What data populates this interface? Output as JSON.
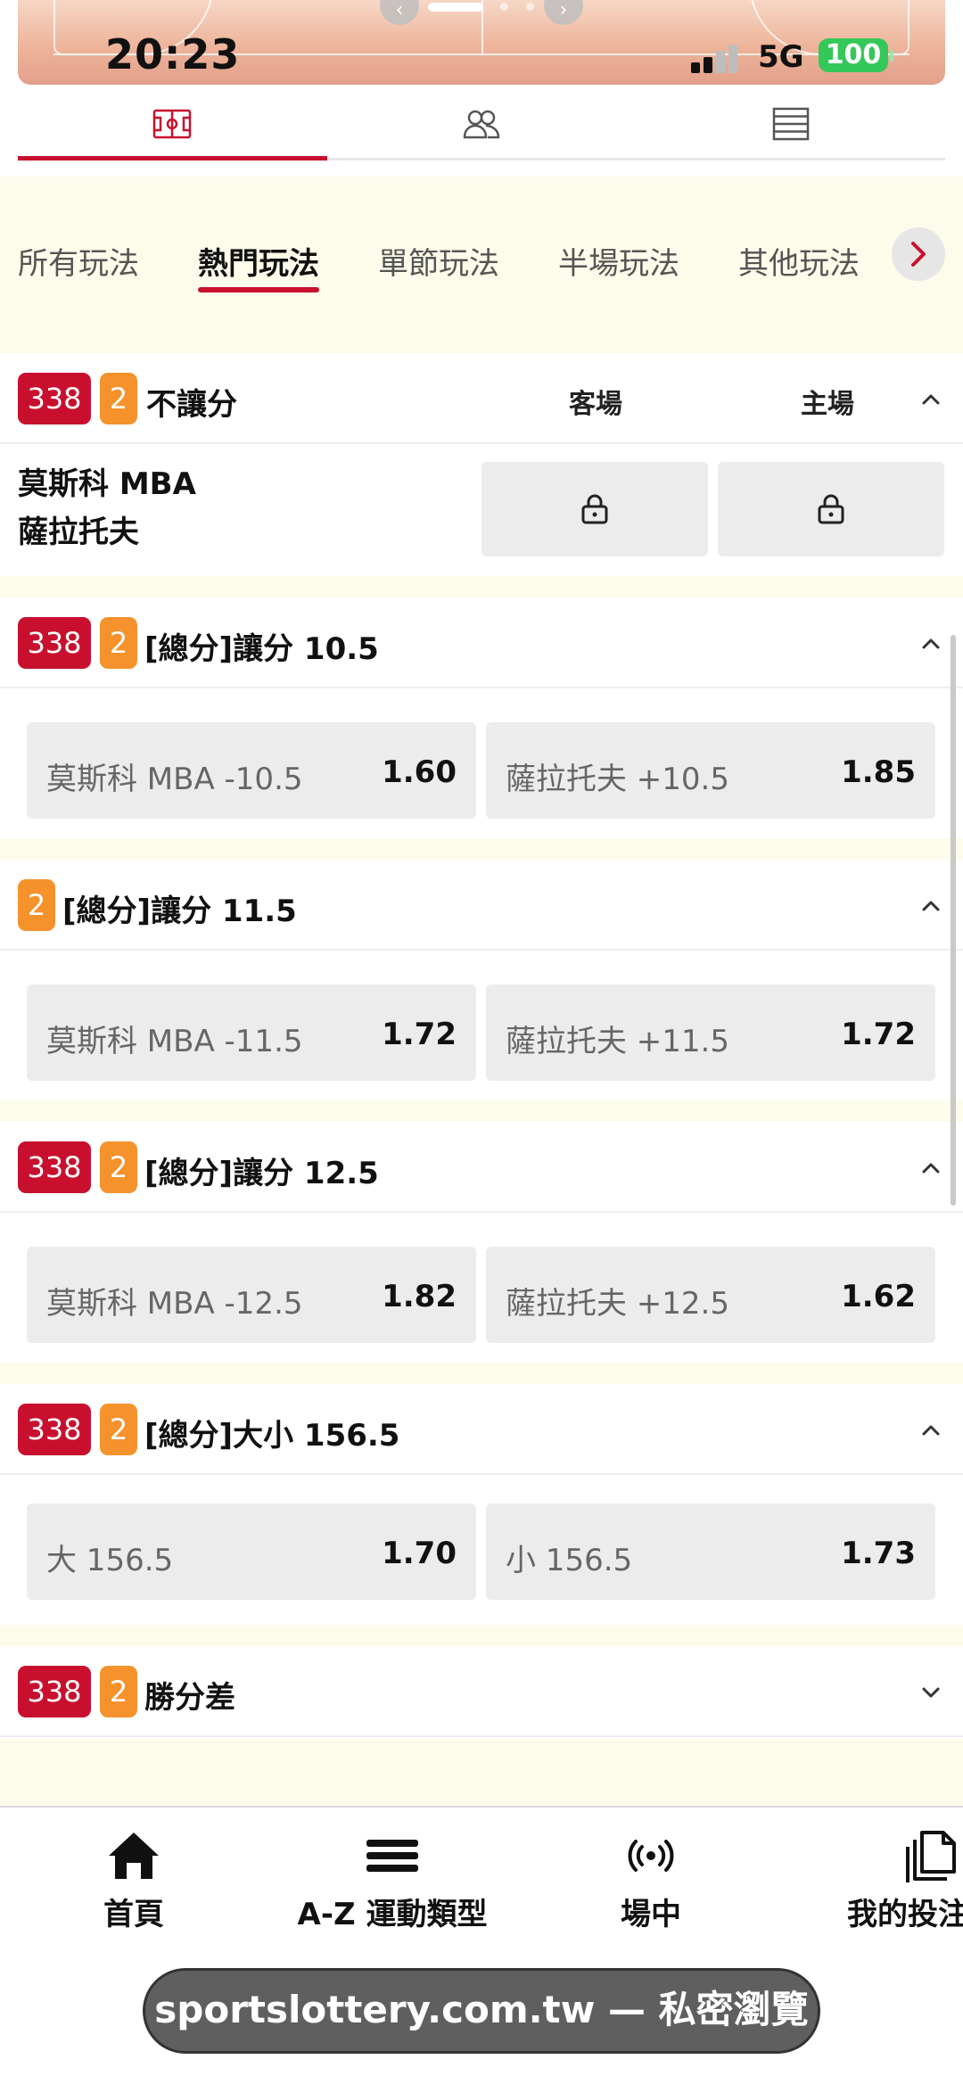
{
  "status_bar": {
    "time": "20:23",
    "network": "5G",
    "battery": "100"
  },
  "icon_tabs": [
    {
      "icon": "basketball-court-icon",
      "active": true
    },
    {
      "icon": "players-icon",
      "active": false
    },
    {
      "icon": "list-icon",
      "active": false
    }
  ],
  "category_tabs": [
    {
      "label": "所有玩法",
      "active": false
    },
    {
      "label": "熱門玩法",
      "active": true
    },
    {
      "label": "單節玩法",
      "active": false
    },
    {
      "label": "半場玩法",
      "active": false
    },
    {
      "label": "其他玩法",
      "active": false
    }
  ],
  "moneyline": {
    "code": "338",
    "count": "2",
    "title": "不讓分",
    "away_header": "客場",
    "home_header": "主場",
    "team_away": "莫斯科 MBA",
    "team_home": "薩拉托夫",
    "locked": true
  },
  "markets": [
    {
      "code": "338",
      "count": "2",
      "title": "[總分]讓分 10.5",
      "expanded": true,
      "left": {
        "label": "莫斯科 MBA -10.5",
        "odds": "1.60"
      },
      "right": {
        "label": "薩拉托夫 +10.5",
        "odds": "1.85"
      }
    },
    {
      "code": "",
      "count": "2",
      "title": "[總分]讓分 11.5",
      "expanded": true,
      "left": {
        "label": "莫斯科 MBA -11.5",
        "odds": "1.72"
      },
      "right": {
        "label": "薩拉托夫 +11.5",
        "odds": "1.72"
      }
    },
    {
      "code": "338",
      "count": "2",
      "title": "[總分]讓分 12.5",
      "expanded": true,
      "left": {
        "label": "莫斯科 MBA -12.5",
        "odds": "1.82"
      },
      "right": {
        "label": "薩拉托夫 +12.5",
        "odds": "1.62"
      }
    },
    {
      "code": "338",
      "count": "2",
      "title": "[總分]大小 156.5",
      "expanded": true,
      "left": {
        "label": "大 156.5",
        "odds": "1.70"
      },
      "right": {
        "label": "小 156.5",
        "odds": "1.73"
      }
    },
    {
      "code": "338",
      "count": "2",
      "title": "勝分差",
      "expanded": false
    }
  ],
  "bottom_nav": [
    {
      "label": "首頁",
      "icon": "home-icon"
    },
    {
      "label": "A-Z 運動類型",
      "icon": "menu-icon"
    },
    {
      "label": "場中",
      "icon": "live-broadcast-icon"
    },
    {
      "label": "我的投注",
      "icon": "my-bets-icon"
    }
  ],
  "browser": {
    "url_text": "sportslottery.com.tw — 私密瀏覽"
  },
  "colors": {
    "brand_red": "#c8102e",
    "count_orange": "#f5922c",
    "cream": "#fdfbea",
    "button_grey": "#ececec"
  }
}
